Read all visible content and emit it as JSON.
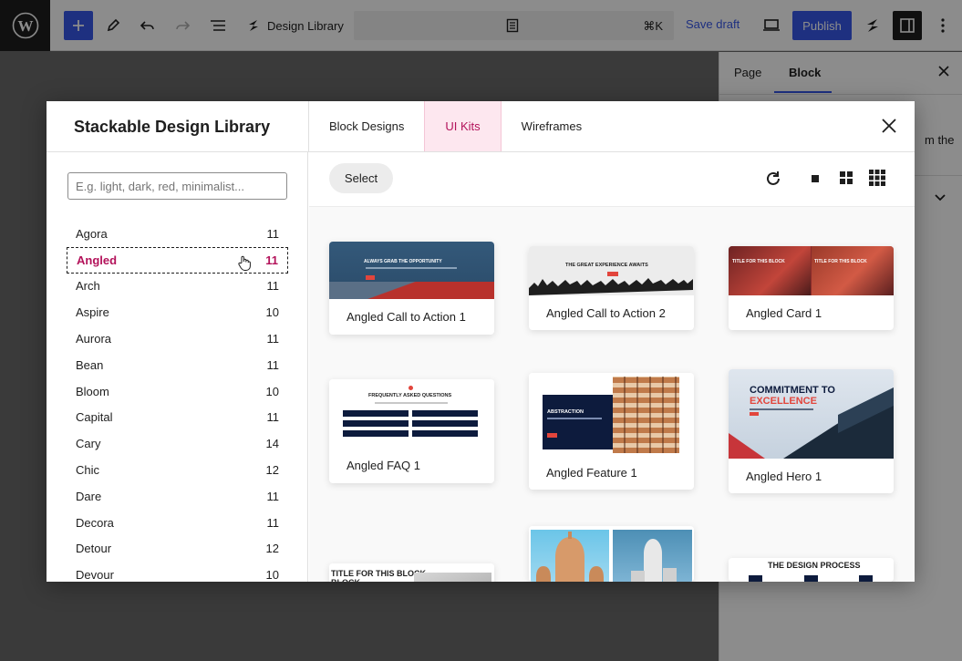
{
  "topbar": {
    "document_title": "Design Library",
    "shortcut": "⌘K",
    "save_draft": "Save draft",
    "publish": "Publish"
  },
  "sidebar": {
    "tabs": [
      "Page",
      "Block"
    ],
    "partial_text": "m the"
  },
  "modal": {
    "title": "Stackable Design Library",
    "tabs": [
      {
        "label": "Block Designs",
        "active": false
      },
      {
        "label": "UI Kits",
        "active": true
      },
      {
        "label": "Wireframes",
        "active": false
      }
    ],
    "search_placeholder": "E.g. light, dark, red, minimalist...",
    "select_label": "Select",
    "categories": [
      {
        "name": "Agora",
        "count": "11"
      },
      {
        "name": "Angled",
        "count": "11",
        "selected": true
      },
      {
        "name": "Arch",
        "count": "11"
      },
      {
        "name": "Aspire",
        "count": "10"
      },
      {
        "name": "Aurora",
        "count": "11"
      },
      {
        "name": "Bean",
        "count": "11"
      },
      {
        "name": "Bloom",
        "count": "10"
      },
      {
        "name": "Capital",
        "count": "11"
      },
      {
        "name": "Cary",
        "count": "14"
      },
      {
        "name": "Chic",
        "count": "12"
      },
      {
        "name": "Dare",
        "count": "11"
      },
      {
        "name": "Decora",
        "count": "11"
      },
      {
        "name": "Detour",
        "count": "12"
      },
      {
        "name": "Devour",
        "count": "10"
      }
    ],
    "cards": [
      {
        "label": "Angled Call to Action 1",
        "thumb_text": "ALWAYS GRAB THE OPPORTUNITY"
      },
      {
        "label": "Angled Call to Action 2",
        "thumb_text": "THE GREAT EXPERIENCE AWAITS"
      },
      {
        "label": "Angled Card 1",
        "thumb_text_a": "TITLE FOR THIS BLOCK",
        "thumb_text_b": "TITLE FOR THIS BLOCK"
      },
      {
        "label": "Angled FAQ 1",
        "thumb_text": "FREQUENTLY ASKED QUESTIONS",
        "grid_item": "TITLE FOR THIS BLOCK"
      },
      {
        "label": "Angled Feature 1",
        "thumb_text": "ABSTRACTION"
      },
      {
        "label": "Angled Hero 1",
        "thumb_text_a": "COMMITMENT TO",
        "thumb_text_b": "EXCELLENCE"
      },
      {
        "label": "",
        "thumb_text": "TITLE FOR THIS BLOCK"
      },
      {
        "label": "",
        "thumb_text": ""
      },
      {
        "label": "",
        "thumb_text": "THE DESIGN PROCESS"
      }
    ]
  },
  "colors": {
    "wp_blue": "#3858e9",
    "stackable_pink": "#b3125a",
    "tab_active_bg": "#fde7ef"
  }
}
